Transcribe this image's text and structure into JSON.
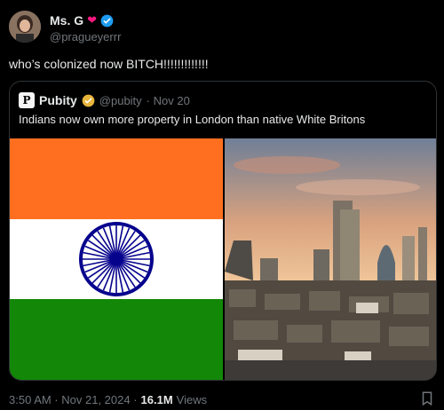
{
  "author": {
    "name": "Ms. G",
    "handle": "@pragueyerrr",
    "heart": "❤",
    "verified_icon": "verified-badge-icon"
  },
  "tweet": {
    "text": "who’s colonized now BITCH!!!!!!!!!!!!!"
  },
  "quote": {
    "name": "Pubity",
    "handle": "@pubity",
    "date": "· Nov 20",
    "text": "Indians now own more property in London than native White Britons",
    "logo_letter": "P"
  },
  "footer": {
    "time": "3:50 AM · Nov 21, 2024 ·",
    "views_count": "16.1M",
    "views_label": "Views"
  },
  "colors": {
    "saffron": "#ff6f1f",
    "white": "#ffffff",
    "green": "#138808",
    "chakra": "#06038d",
    "verified": "#1d9bf0",
    "gold": "#e8b53c"
  }
}
